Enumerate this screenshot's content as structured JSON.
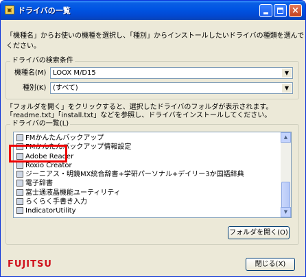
{
  "window": {
    "title": "ドライバの一覧"
  },
  "instruction": "「機種名」からお使いの機種を選択し、「種別」からインストールしたいドライバの種類を選んでください。",
  "search": {
    "legend": "ドライバの検索条件",
    "model_label": "機種名(M)",
    "model_value": "LOOX M/D15",
    "type_label": "種別(K)",
    "type_value": "(すべて)"
  },
  "note": {
    "line1": "「フォルダを開く」をクリックすると、選択したドライバのフォルダが表示されます。",
    "line2": "「readme.txt」「install.txt」などを参照し、ドライバをインストールしてください。"
  },
  "list": {
    "legend": "ドライバの一覧(L)",
    "items": [
      "FMかんたんバックアップ",
      "FMかんたんバックアップ情報設定",
      "Adobe Reader",
      "Roxio Creator",
      "ジーニアス・明鏡MX統合辞書+学研パーソナル+デイリー3か国語辞典",
      "電子辞書",
      "富士通液晶機能ユーティリティ",
      "らくらく手書き入力",
      "IndicatorUtility"
    ]
  },
  "buttons": {
    "open_folder": "フォルダを開く(O)",
    "close": "閉じる(X)"
  },
  "brand": {
    "logo_text": "FUJITSU"
  },
  "colors": {
    "highlight": "#ee0000",
    "brand": "#d0101b",
    "titlebar": "#0054e3"
  }
}
